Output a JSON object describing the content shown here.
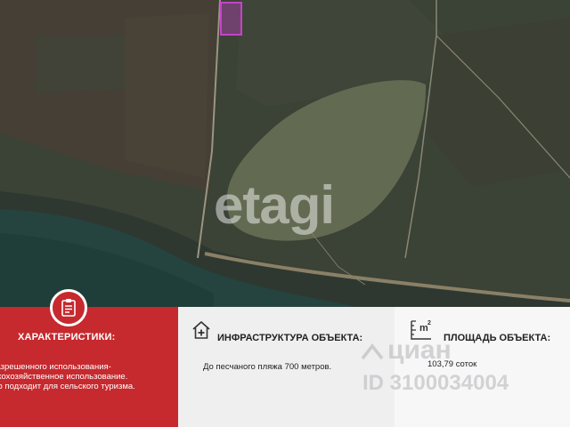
{
  "map": {
    "watermark": "etagi",
    "colors": {
      "land": "#3b4236",
      "sea": "#25443f",
      "marker": "#c642c9"
    }
  },
  "features": {
    "badge_icon": "clipboard-icon",
    "title": "ХАРАКТЕРИСТИКИ:",
    "lines": [
      "д разрешенного использования-",
      "льскохозяйственное использование.",
      "ично подходит для сельского туризма."
    ],
    "accent_color": "#c6292e"
  },
  "infrastructure": {
    "icon": "house-plus-icon",
    "title": "ИНФРАСТРУКТУРА ОБЪЕКТА:",
    "text": "До песчаного пляжа 700 метров."
  },
  "area": {
    "icon": "area-m2-icon",
    "icon_label": "m",
    "icon_sup": "2",
    "title": "ПЛОЩАДЬ ОБЪЕКТА:",
    "text": "103,79 соток"
  },
  "cian_watermark": {
    "brand": "циан",
    "id": "ID 3100034004"
  }
}
